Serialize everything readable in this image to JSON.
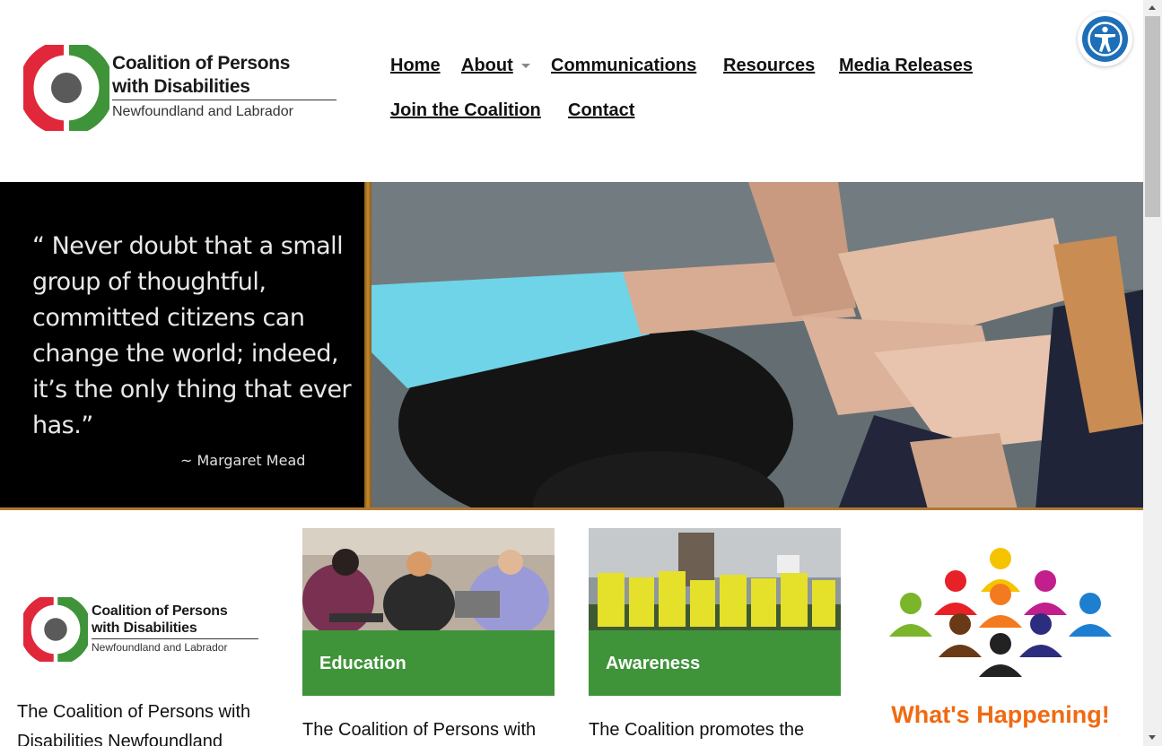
{
  "header": {
    "logo": {
      "line1": "Coalition of Persons",
      "line2": "with Disabilities",
      "line3": "Newfoundland and Labrador"
    },
    "nav": [
      {
        "label": "Home",
        "dropdown": false
      },
      {
        "label": "About",
        "dropdown": true
      },
      {
        "label": "Communications",
        "dropdown": false
      },
      {
        "label": "Resources",
        "dropdown": false
      },
      {
        "label": "Media Releases",
        "dropdown": false
      },
      {
        "label": "Join the Coalition",
        "dropdown": false
      },
      {
        "label": "Contact",
        "dropdown": false
      }
    ],
    "accessibility_icon": "accessibility-icon"
  },
  "hero": {
    "quote": "“ Never doubt that a small group of thoughtful, committed citizens can change the world; indeed, it’s the only thing that ever has.”",
    "attribution": "~ Margaret Mead"
  },
  "columns": {
    "about": {
      "logo": {
        "line1": "Coalition of Persons",
        "line2": "with Disabilities",
        "line3": "Newfoundland and Labrador"
      },
      "text": "The Coalition of Persons with Disabilities Newfoundland"
    },
    "education": {
      "label": "Education",
      "text": "The Coalition of Persons with"
    },
    "awareness": {
      "label": "Awareness",
      "text": "The Coalition promotes the"
    },
    "happening": {
      "label": "What's Happening!"
    }
  },
  "colors": {
    "brand_green": "#3f943a",
    "brand_red": "#e0283a",
    "accent_orange": "#f06a12",
    "a11y_blue": "#1e6fb8"
  }
}
